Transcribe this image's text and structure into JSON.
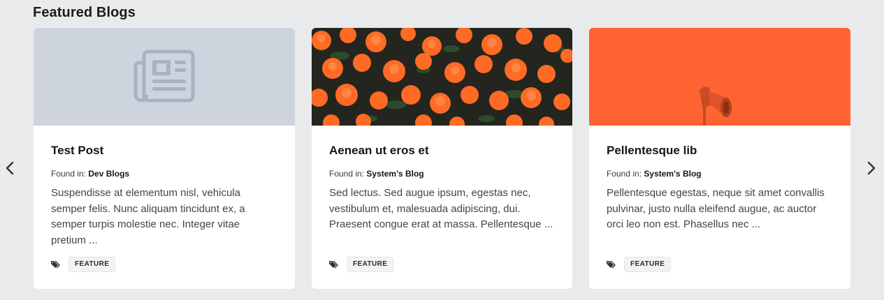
{
  "section": {
    "title": "Featured Blogs"
  },
  "nav": {
    "prev": "chevron-left-icon",
    "next": "chevron-right-icon"
  },
  "found_in_label": "Found in:",
  "cards": [
    {
      "title": "Test Post",
      "blog": "Dev Blogs",
      "excerpt": "Suspendisse at elementum nisl, vehicula semper felis. Nunc aliquam tincidunt ex, a semper turpis molestie nec. Integer vitae pretium ...",
      "tag": "FEATURE",
      "image": "newspaper-placeholder-icon"
    },
    {
      "title": "Aenean ut eros et",
      "blog": "System's Blog",
      "excerpt": "Sed lectus. Sed augue ipsum, egestas nec, vestibulum et, malesuada adipiscing, dui. Praesent congue erat at massa. Pellentesque ...",
      "tag": "FEATURE",
      "image": "orange-flowers-photo"
    },
    {
      "title": "Pellentesque lib",
      "blog": "System's Blog",
      "excerpt": "Pellentesque egestas, neque sit amet convallis pulvinar, justo nulla eleifend augue, ac auctor orci leo non est. Phasellus nec ...",
      "tag": "FEATURE",
      "image": "megaphone-on-orange-photo"
    }
  ],
  "colors": {
    "background": "#e9eaec",
    "placeholder": "#cdd4de",
    "placeholder_icon": "#a9b2c3",
    "orange": "#ff6332",
    "flower": "#ff6a25"
  }
}
